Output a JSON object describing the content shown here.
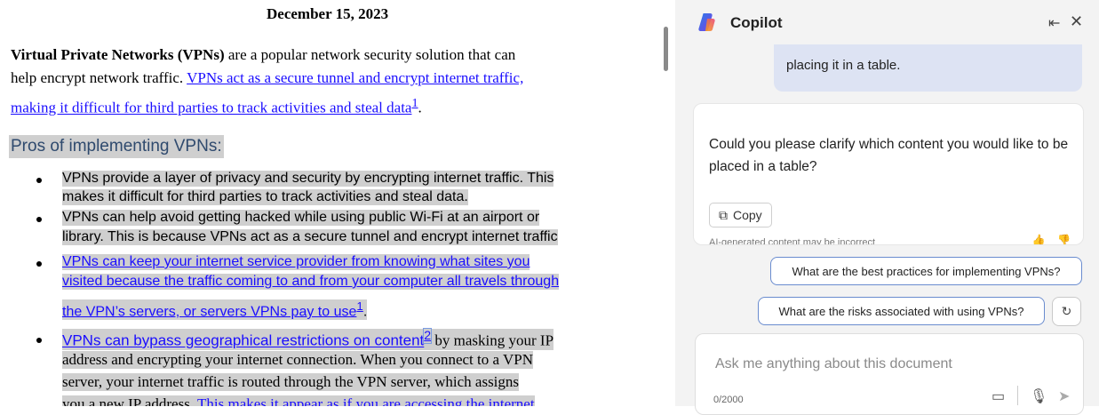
{
  "document": {
    "date": "December 15, 2023",
    "intro": {
      "bold": "Virtual Private Networks (VPNs)",
      "line1_rest": " are a popular network security solution that can",
      "line2_plain": "help encrypt network traffic. ",
      "line2_link": "VPNs act as a secure tunnel and encrypt internet traffic,",
      "line3_link": "making it difficult for third parties to track activities and steal data",
      "line3_sup": "1",
      "line3_end": "."
    },
    "heading": "Pros of implementing VPNs:",
    "bullets": {
      "b1_l1": "VPNs provide a layer of privacy and security by encrypting internet traffic. This",
      "b1_l2": "makes it difficult for third parties to track activities and steal data.",
      "b2_l1": "VPNs can help avoid getting hacked while using public Wi-Fi at an airport or",
      "b2_l2": "library. This is because VPNs act as a secure tunnel and encrypt internet traffic",
      "b3_l1": "VPNs can keep your internet service provider from knowing what sites you",
      "b3_l2": "visited because the traffic coming to and from your computer all travels through",
      "b3_l3": "the VPN’s servers, or servers VPNs pay to use",
      "b3_sup": "1",
      "b3_end": ".",
      "b4_link": "VPNs can bypass geographical restrictions on content",
      "b4_sup": "2",
      "b4_l1_rest": " by masking your IP",
      "b4_l2": "address and encrypting your internet connection. When you connect to a VPN",
      "b4_l3": "server, your internet traffic is routed through the VPN server, which assigns",
      "b4_l4_plain": "you a new IP address. ",
      "b4_l4_link": "This makes it appear as if you are accessing the internet"
    }
  },
  "copilot": {
    "title": "Copilot",
    "user_message_tail": "placing it in a table.",
    "response": "Could you please clarify which content you would like to be placed in a table?",
    "copy_label": "Copy",
    "disclaimer": "AI-generated content may be incorrect",
    "suggestions": [
      "What are the best practices for implementing VPNs?",
      "What are the risks associated with using VPNs?"
    ],
    "input_placeholder": "Ask me anything about this document",
    "char_count": "0/2000"
  },
  "icons": {
    "logo": "copilot-logo",
    "header": [
      "dock-pane-icon",
      "close-icon"
    ],
    "copy": "copy-icon",
    "refresh": "refresh-icon",
    "input": [
      "notebook-icon",
      "microphone-icon",
      "send-icon"
    ]
  },
  "colors": {
    "link": "#1a0dff",
    "highlight": "#cfcfcf",
    "suggestion_border": "#6a8ccf",
    "user_bubble": "#dde3f3"
  }
}
